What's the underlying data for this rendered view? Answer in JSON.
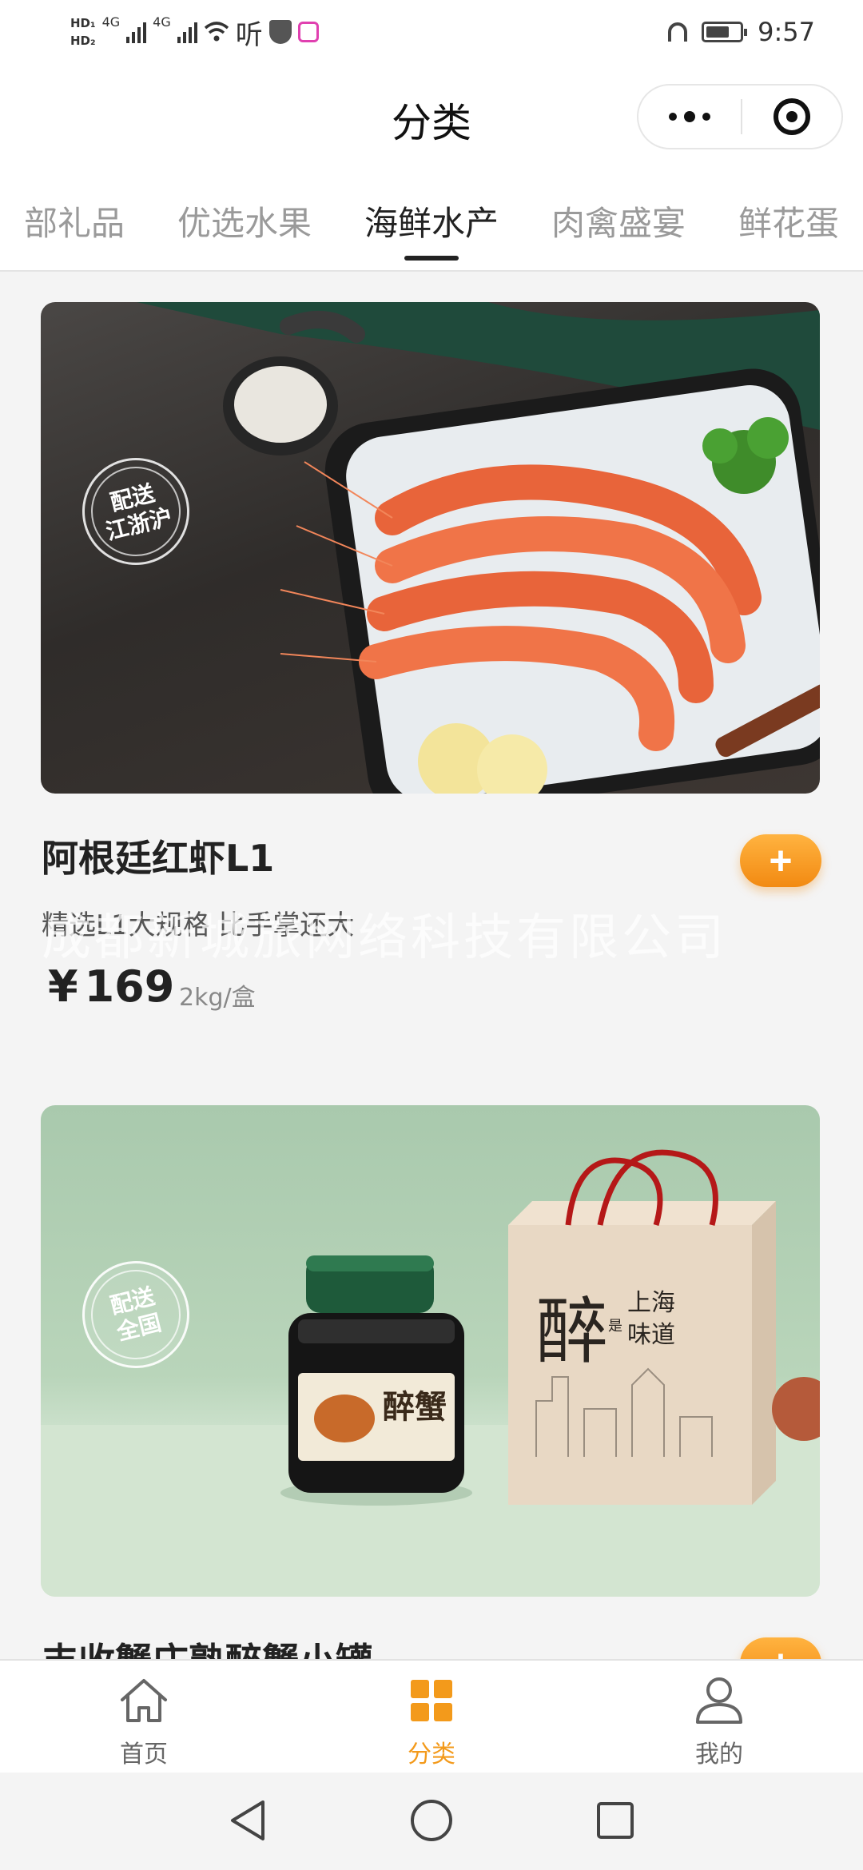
{
  "status_bar": {
    "hd_top": "HD₁",
    "hd_bottom": "HD₂",
    "net1": "4G",
    "net2": "4G",
    "ting": "听",
    "time": "9:57"
  },
  "header": {
    "title": "分类"
  },
  "tabs": [
    {
      "label": "部礼品",
      "active": false
    },
    {
      "label": "优选水果",
      "active": false
    },
    {
      "label": "海鲜水产",
      "active": true
    },
    {
      "label": "肉禽盛宴",
      "active": false
    },
    {
      "label": "鲜花蛋",
      "active": false
    }
  ],
  "products": [
    {
      "badge_line1": "配送",
      "badge_line2": "江浙沪",
      "name": "阿根廷红虾L1",
      "desc": "精选L1大规格 比手掌还大",
      "currency": "¥",
      "price": "169",
      "unit": "2kg/盒",
      "add_label": "+"
    },
    {
      "badge_line1": "配送",
      "badge_line2": "全国",
      "name": "丰收蟹庄熟醉蟹小罐",
      "add_label": "+",
      "jar_label": "醉蟹",
      "bag_big": "醉",
      "bag_small": "是",
      "bag_text1": "上海",
      "bag_text2": "味道"
    }
  ],
  "watermark": "成都新城旅网络科技有限公司",
  "bottom_nav": [
    {
      "label": "首页",
      "icon": "home-icon",
      "active": false
    },
    {
      "label": "分类",
      "icon": "category-grid-icon",
      "active": true
    },
    {
      "label": "我的",
      "icon": "user-icon",
      "active": false
    }
  ],
  "colors": {
    "accent": "#f39a1b",
    "add_button": "#f59a22"
  }
}
